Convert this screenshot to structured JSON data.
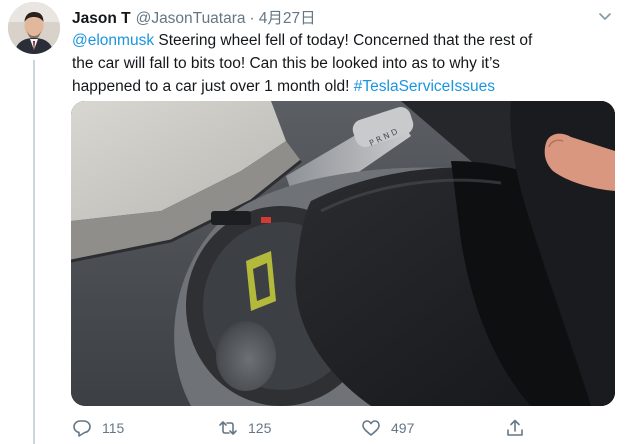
{
  "tweet": {
    "display_name": "Jason T",
    "handle": "@JasonTuatara",
    "separator": "·",
    "date": "4月27日",
    "text_lines": [
      {
        "mention": "@elonmusk",
        "text": " Steering wheel fell of today! Concerned that the rest of"
      },
      {
        "text": "the car will fall to bits too!  Can this be looked into as to why it’s"
      },
      {
        "text": "happened to a car just over 1 month old! ",
        "hashtag": "#TeslaServiceIssues"
      }
    ],
    "stats": {
      "replies": "115",
      "retweets": "125",
      "likes": "497"
    }
  },
  "icons": {
    "more": "chevron-down-icon",
    "reply": "reply-icon",
    "retweet": "retweet-icon",
    "like": "heart-icon",
    "share": "share-icon"
  },
  "colors": {
    "link": "#1b95e0",
    "secondary_text": "#657786",
    "thread_line": "#ccd6dd"
  }
}
